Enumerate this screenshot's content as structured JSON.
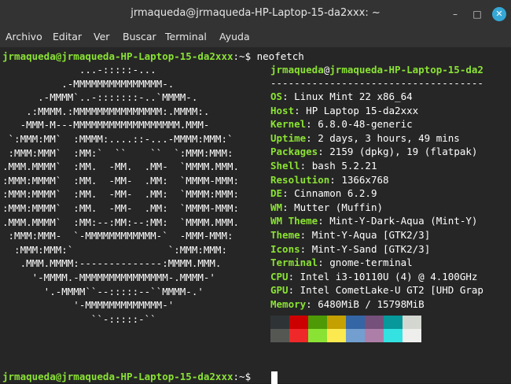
{
  "window": {
    "title": "jrmaqueda@jrmaqueda-HP-Laptop-15-da2xxx: ~",
    "controls": {
      "minimize": "–",
      "maximize": "□",
      "close": "✕"
    }
  },
  "menubar": {
    "items": [
      "Archivo",
      "Editar",
      "Ver",
      "Buscar",
      "Terminal",
      "Ayuda"
    ]
  },
  "terminal": {
    "prompt_user_host": "jrmaqueda@jrmaqueda-HP-Laptop-15-da2xxx",
    "prompt_cwd": ":~",
    "prompt_symbol": "$",
    "command": "neofetch",
    "logo": [
      "             ...-:::::-...",
      "          .-MMMMMMMMMMMMMMM-.",
      "      .-MMMM`..-:::::::-..`MMMM-.",
      "    .:MMMM.:MMMMMMMMMMMMMMM:.MMMM:.",
      "   -MMM-M---MMMMMMMMMMMMMMMMMM.MMM-",
      " `:MMM:MM`  :MMMM:....::-...-MMMM:MMM:`",
      " :MMM:MMM`  :MM:`  ``    ``  `:MMM:MMM:",
      ".MMM.MMMM`  :MM.  -MM.  .MM-  `MMMM.MMM.",
      ":MMM:MMMM`  :MM.  -MM-  .MM:  `MMMM-MMM:",
      ":MMM:MMMM`  :MM.  -MM-  .MM:  `MMMM:MMM:",
      ":MMM:MMMM`  :MM.  -MM-  .MM:  `MMMM-MMM:",
      ".MMM.MMMM`  :MM:--:MM:--:MM:  `MMMM.MMM.",
      " :MMM:MMM-  `-MMMMMMMMMMMM-`  -MMM-MMM:",
      "  :MMM:MMM:`                `:MMM:MMM:",
      "   .MMM.MMMM:--------------:MMMM.MMM.",
      "     '-MMMM.-MMMMMMMMMMMMMMM-.MMMM-'",
      "       '.-MMMM``--:::::--``MMMM-.'",
      "            '-MMMMMMMMMMMMM-'",
      "               ``-:::::-``"
    ],
    "info_header_user": "jrmaqueda",
    "info_header_at": "@",
    "info_header_host": "jrmaqueda-HP-Laptop-15-da2",
    "separator": "------------------------------------",
    "info": [
      {
        "key": "OS",
        "value": "Linux Mint 22 x86_64"
      },
      {
        "key": "Host",
        "value": "HP Laptop 15-da2xxx"
      },
      {
        "key": "Kernel",
        "value": "6.8.0-48-generic"
      },
      {
        "key": "Uptime",
        "value": "2 days, 3 hours, 49 mins"
      },
      {
        "key": "Packages",
        "value": "2159 (dpkg), 19 (flatpak)"
      },
      {
        "key": "Shell",
        "value": "bash 5.2.21"
      },
      {
        "key": "Resolution",
        "value": "1366x768"
      },
      {
        "key": "DE",
        "value": "Cinnamon 6.2.9"
      },
      {
        "key": "WM",
        "value": "Mutter (Muffin)"
      },
      {
        "key": "WM Theme",
        "value": "Mint-Y-Dark-Aqua (Mint-Y)"
      },
      {
        "key": "Theme",
        "value": "Mint-Y-Aqua [GTK2/3]"
      },
      {
        "key": "Icons",
        "value": "Mint-Y-Sand [GTK2/3]"
      },
      {
        "key": "Terminal",
        "value": "gnome-terminal"
      },
      {
        "key": "CPU",
        "value": "Intel i3-10110U (4) @ 4.100GHz"
      },
      {
        "key": "GPU",
        "value": "Intel CometLake-U GT2 [UHD Grap"
      },
      {
        "key": "Memory",
        "value": "6480MiB / 15798MiB"
      }
    ],
    "palette_row1": [
      "#2e3436",
      "#cc0000",
      "#4e9a06",
      "#c4a000",
      "#3465a4",
      "#75507b",
      "#06989a",
      "#d3d7cf"
    ],
    "palette_row2": [
      "#555753",
      "#ef2929",
      "#8ae234",
      "#fce94f",
      "#729fcf",
      "#ad7fa8",
      "#34e2e2",
      "#eeeeec"
    ]
  }
}
